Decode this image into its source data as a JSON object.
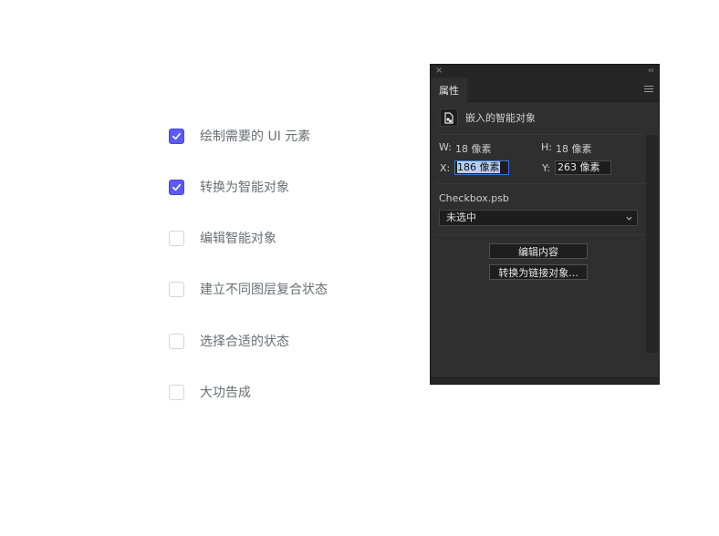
{
  "checklist": {
    "items": [
      {
        "label": "绘制需要的 UI 元素",
        "checked": true
      },
      {
        "label": "转换为智能对象",
        "checked": true
      },
      {
        "label": "编辑智能对象",
        "checked": false
      },
      {
        "label": "建立不同图层复合状态",
        "checked": false
      },
      {
        "label": "选择合适的状态",
        "checked": false
      },
      {
        "label": "大功告成",
        "checked": false
      }
    ]
  },
  "panel": {
    "close_glyph": "×",
    "collapse_glyph": "‹‹",
    "tab_label": "属性",
    "object_type": "嵌入的智能对象",
    "w_label": "W:",
    "w_value": "18 像素",
    "h_label": "H:",
    "h_value": "18 像素",
    "x_label": "X:",
    "x_value": "186 像素",
    "y_label": "Y:",
    "y_value": "263 像素",
    "filename": "Checkbox.psb",
    "state_selected": "未选中",
    "edit_button": "编辑内容",
    "convert_button": "转换为链接对象..."
  },
  "colors": {
    "accent": "#5b5bf0",
    "panel_bg": "#2f2f2f",
    "label_text": "#6b6e76"
  }
}
